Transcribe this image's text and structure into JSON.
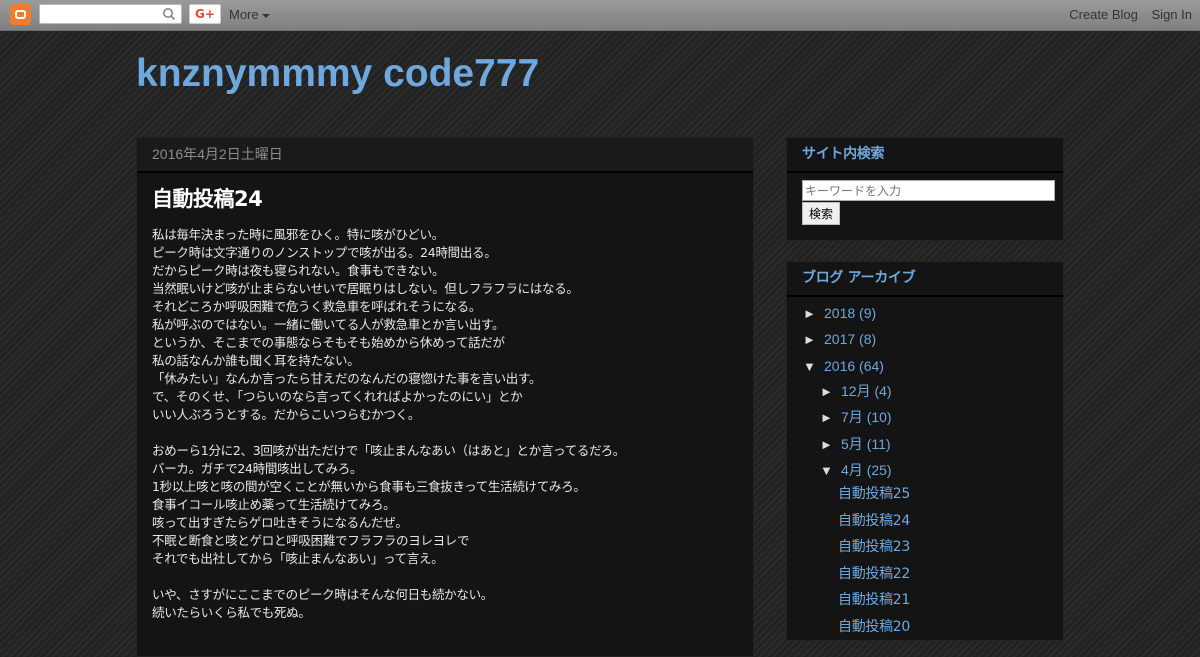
{
  "navbar": {
    "search_placeholder": "",
    "gplus_label": "G+",
    "more_label": "More",
    "create_blog": "Create Blog",
    "sign_in": "Sign In"
  },
  "blog": {
    "title": "knznymmmy code777"
  },
  "post": {
    "date": "2016年4月2日土曜日",
    "title": "自動投稿24",
    "paragraph1": [
      "私は毎年決まった時に風邪をひく。特に咳がひどい。",
      "ピーク時は文字通りのノンストップで咳が出る。24時間出る。",
      "だからピーク時は夜も寝られない。食事もできない。",
      "当然眠いけど咳が止まらないせいで居眠りはしない。但しフラフラにはなる。",
      "それどころか呼吸困難で危うく救急車を呼ばれそうになる。",
      "私が呼ぶのではない。一緒に働いてる人が救急車とか言い出す。",
      "というか、そこまでの事態ならそもそも始めから休めって話だが",
      "私の話なんか誰も聞く耳を持たない。",
      "「休みたい」なんか言ったら甘えだのなんだの寝惚けた事を言い出す。",
      "で、そのくせ、「つらいのなら言ってくれればよかったのにい」とか",
      "いい人ぶろうとする。だからこいつらむかつく。"
    ],
    "paragraph2": [
      "おめーら1分に2、3回咳が出ただけで「咳止まんなあい（はあと」とか言ってるだろ。",
      "バーカ。ガチで24時間咳出してみろ。",
      "1秒以上咳と咳の間が空くことが無いから食事も三食抜きって生活続けてみろ。",
      "食事イコール咳止め薬って生活続けてみろ。",
      "咳って出すぎたらゲロ吐きそうになるんだぜ。",
      "不眠と断食と咳とゲロと呼吸困難でフラフラのヨレヨレで",
      "それでも出社してから「咳止まんなあい」って言え。"
    ],
    "paragraph3": [
      "いや、さすがにここまでのピーク時はそんな何日も続かない。",
      "続いたらいくら私でも死ぬ。"
    ]
  },
  "sidebar": {
    "search": {
      "title": "サイト内検索",
      "placeholder": "キーワードを入力",
      "button": "検索"
    },
    "archive": {
      "title": "ブログ アーカイブ",
      "years": [
        {
          "toggle": "►",
          "label": "2018",
          "count": "(9)"
        },
        {
          "toggle": "►",
          "label": "2017",
          "count": "(8)"
        },
        {
          "toggle": "▼",
          "label": "2016",
          "count": "(64)"
        }
      ],
      "months": [
        {
          "toggle": "►",
          "label": "12月",
          "count": "(4)"
        },
        {
          "toggle": "►",
          "label": "7月",
          "count": "(10)"
        },
        {
          "toggle": "►",
          "label": "5月",
          "count": "(11)"
        },
        {
          "toggle": "▼",
          "label": "4月",
          "count": "(25)"
        }
      ],
      "posts": [
        "自動投稿25",
        "自動投稿24",
        "自動投稿23",
        "自動投稿22",
        "自動投稿21",
        "自動投稿20"
      ]
    }
  }
}
